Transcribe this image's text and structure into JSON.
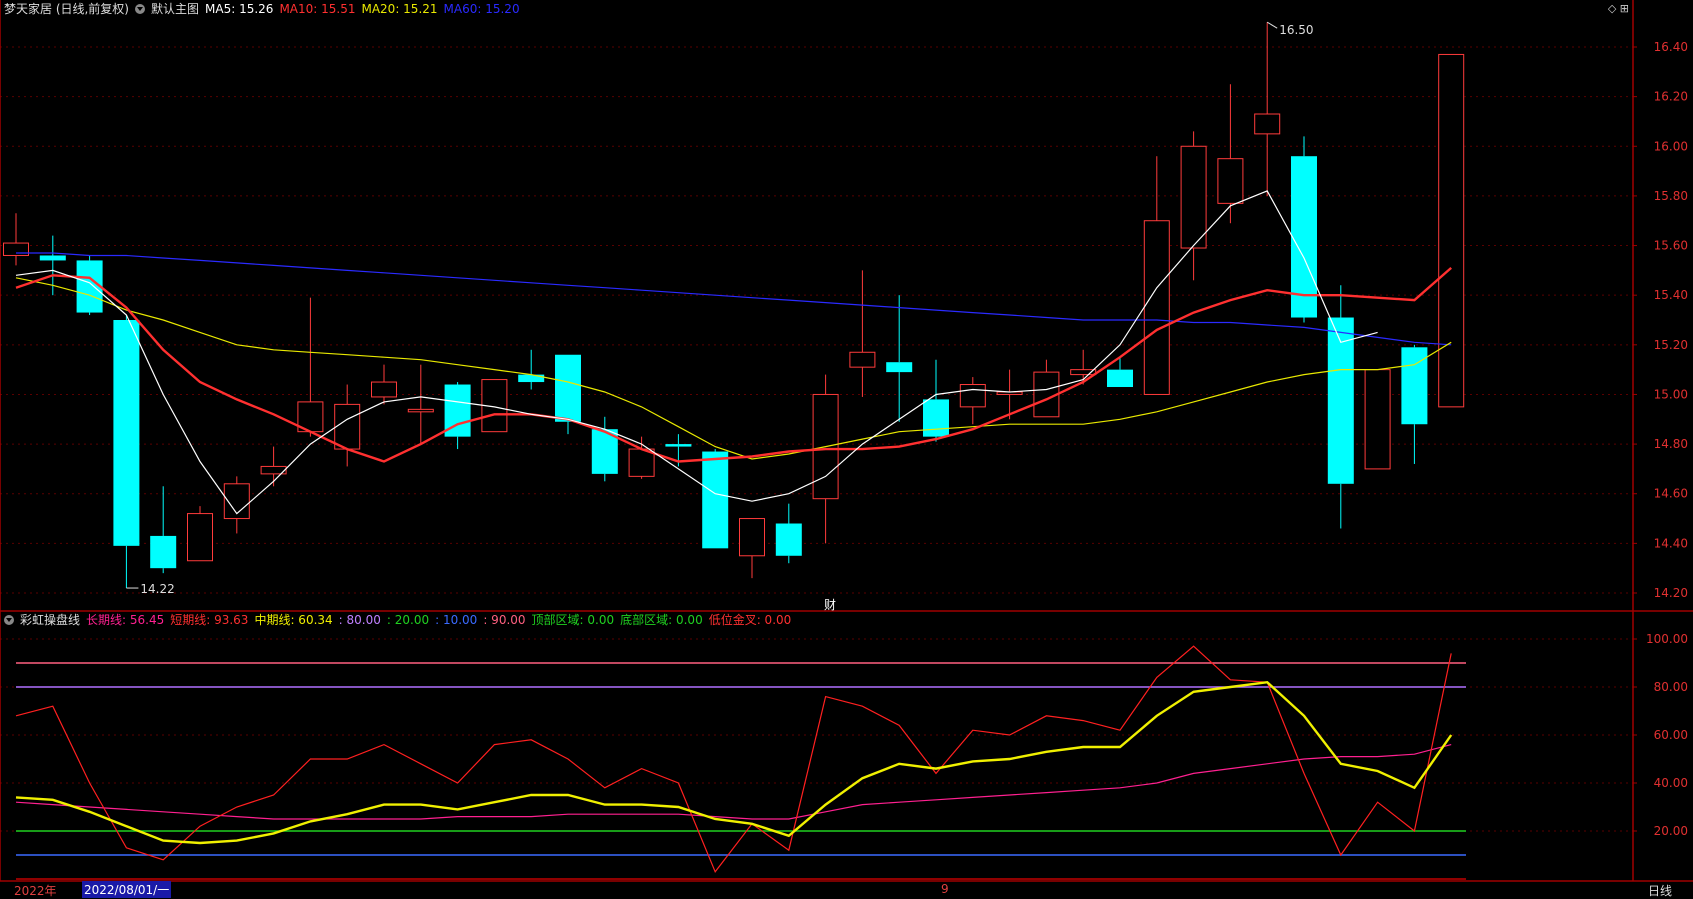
{
  "header": {
    "stock_name": "梦天家居 (日线,前复权)",
    "chart_type_label": "默认主图",
    "ma": [
      {
        "label": "MA5: 15.26",
        "color": "#ffffff"
      },
      {
        "label": "MA10: 15.51",
        "color": "#ff3030"
      },
      {
        "label": "MA20: 15.21",
        "color": "#e8e800"
      },
      {
        "label": "MA60: 15.20",
        "color": "#2a2aff"
      }
    ]
  },
  "indicator_header": {
    "name": "彩虹操盘线",
    "items": [
      {
        "label": "长期线: 56.45",
        "color": "#ff2090"
      },
      {
        "label": "短期线: 93.63",
        "color": "#ff3030"
      },
      {
        "label": "中期线: 60.34",
        "color": "#f0f000"
      },
      {
        "label": ": 80.00",
        "color": "#c080ff"
      },
      {
        "label": ": 20.00",
        "color": "#20d020"
      },
      {
        "label": ": 10.00",
        "color": "#3a6aff"
      },
      {
        "label": ": 90.00",
        "color": "#ff6080"
      },
      {
        "label": "顶部区域: 0.00",
        "color": "#20d020"
      },
      {
        "label": "底部区域: 0.00",
        "color": "#20d020"
      },
      {
        "label": "低位金叉: 0.00",
        "color": "#ff3030"
      }
    ]
  },
  "corner_icons": "◇ ⊞",
  "timeline": {
    "year_label": "2022年",
    "cursor_date": "2022/08/01/一",
    "mid_label": "9",
    "period": "日线"
  },
  "marker_cai": "财",
  "annotations": {
    "high": "16.50",
    "low": "14.22"
  },
  "colors": {
    "up": "#ff3b3b",
    "down": "#00ffff",
    "grid": "#5a0000",
    "axis": "#a00000"
  },
  "chart_data": [
    {
      "type": "candlestick",
      "title": "梦天家居",
      "ylim": [
        14.14,
        16.6
      ],
      "y_ticks": [
        14.2,
        14.4,
        14.6,
        14.8,
        15.0,
        15.2,
        15.4,
        15.6,
        15.8,
        16.0,
        16.2,
        16.4
      ],
      "candles": [
        {
          "o": 15.56,
          "h": 15.73,
          "l": 15.52,
          "c": 15.61
        },
        {
          "o": 15.56,
          "h": 15.64,
          "l": 15.4,
          "c": 15.54
        },
        {
          "o": 15.54,
          "h": 15.56,
          "l": 15.32,
          "c": 15.33
        },
        {
          "o": 15.3,
          "h": 15.32,
          "l": 14.22,
          "c": 14.39
        },
        {
          "o": 14.43,
          "h": 14.63,
          "l": 14.28,
          "c": 14.3
        },
        {
          "o": 14.33,
          "h": 14.55,
          "l": 14.33,
          "c": 14.52
        },
        {
          "o": 14.5,
          "h": 14.67,
          "l": 14.44,
          "c": 14.64
        },
        {
          "o": 14.68,
          "h": 14.79,
          "l": 14.63,
          "c": 14.71
        },
        {
          "o": 14.85,
          "h": 15.39,
          "l": 14.83,
          "c": 14.97
        },
        {
          "o": 14.78,
          "h": 15.04,
          "l": 14.71,
          "c": 14.96
        },
        {
          "o": 14.99,
          "h": 15.12,
          "l": 14.96,
          "c": 15.05
        },
        {
          "o": 14.93,
          "h": 15.12,
          "l": 14.8,
          "c": 14.94
        },
        {
          "o": 15.04,
          "h": 15.05,
          "l": 14.78,
          "c": 14.83
        },
        {
          "o": 14.85,
          "h": 15.06,
          "l": 14.85,
          "c": 15.06
        },
        {
          "o": 15.08,
          "h": 15.18,
          "l": 15.02,
          "c": 15.05
        },
        {
          "o": 15.16,
          "h": 15.16,
          "l": 14.84,
          "c": 14.89
        },
        {
          "o": 14.86,
          "h": 14.91,
          "l": 14.65,
          "c": 14.68
        },
        {
          "o": 14.67,
          "h": 14.83,
          "l": 14.66,
          "c": 14.78
        },
        {
          "o": 14.8,
          "h": 14.84,
          "l": 14.71,
          "c": 14.79
        },
        {
          "o": 14.77,
          "h": 14.78,
          "l": 14.38,
          "c": 14.38
        },
        {
          "o": 14.35,
          "h": 14.5,
          "l": 14.26,
          "c": 14.5
        },
        {
          "o": 14.48,
          "h": 14.56,
          "l": 14.32,
          "c": 14.35
        },
        {
          "o": 14.58,
          "h": 15.08,
          "l": 14.4,
          "c": 15.0
        },
        {
          "o": 15.11,
          "h": 15.5,
          "l": 14.99,
          "c": 15.17
        },
        {
          "o": 15.13,
          "h": 15.4,
          "l": 14.89,
          "c": 15.09
        },
        {
          "o": 14.98,
          "h": 15.14,
          "l": 14.81,
          "c": 14.83
        },
        {
          "o": 14.95,
          "h": 15.07,
          "l": 14.88,
          "c": 15.04
        },
        {
          "o": 15.0,
          "h": 15.1,
          "l": 14.9,
          "c": 15.01
        },
        {
          "o": 14.91,
          "h": 15.14,
          "l": 14.91,
          "c": 15.09
        },
        {
          "o": 15.08,
          "h": 15.18,
          "l": 15.04,
          "c": 15.1
        },
        {
          "o": 15.1,
          "h": 15.15,
          "l": 15.04,
          "c": 15.03
        },
        {
          "o": 15.0,
          "h": 15.96,
          "l": 15.0,
          "c": 15.7
        },
        {
          "o": 15.59,
          "h": 16.06,
          "l": 15.46,
          "c": 16.0
        },
        {
          "o": 15.77,
          "h": 16.25,
          "l": 15.69,
          "c": 15.95
        },
        {
          "o": 16.05,
          "h": 16.5,
          "l": 15.8,
          "c": 16.13
        },
        {
          "o": 15.96,
          "h": 16.04,
          "l": 15.29,
          "c": 15.31
        },
        {
          "o": 15.31,
          "h": 15.44,
          "l": 14.46,
          "c": 14.64
        },
        {
          "o": 14.7,
          "h": 15.1,
          "l": 14.7,
          "c": 15.1
        },
        {
          "o": 15.19,
          "h": 15.2,
          "l": 14.72,
          "c": 14.88
        },
        {
          "o": 14.95,
          "h": 16.37,
          "l": 14.95,
          "c": 16.37
        }
      ],
      "ma5": [
        15.48,
        15.5,
        15.45,
        15.32,
        15.0,
        14.73,
        14.52,
        14.65,
        14.8,
        14.9,
        14.97,
        14.99,
        14.97,
        14.95,
        14.92,
        14.9,
        14.86,
        14.8,
        14.7,
        14.6,
        14.57,
        14.6,
        14.67,
        14.8,
        14.9,
        15.0,
        15.02,
        15.01,
        15.02,
        15.06,
        15.2,
        15.43,
        15.6,
        15.76,
        15.82,
        15.55,
        15.21,
        15.25
      ],
      "ma10": [
        15.43,
        15.48,
        15.47,
        15.35,
        15.18,
        15.05,
        14.98,
        14.92,
        14.85,
        14.78,
        14.73,
        14.8,
        14.88,
        14.92,
        14.92,
        14.9,
        14.85,
        14.78,
        14.73,
        14.74,
        14.75,
        14.77,
        14.78,
        14.78,
        14.79,
        14.82,
        14.86,
        14.92,
        14.98,
        15.05,
        15.15,
        15.26,
        15.33,
        15.38,
        15.42,
        15.4,
        15.4,
        15.39,
        15.38,
        15.51
      ],
      "ma20": [
        15.47,
        15.44,
        15.4,
        15.34,
        15.3,
        15.25,
        15.2,
        15.18,
        15.17,
        15.16,
        15.15,
        15.14,
        15.12,
        15.1,
        15.08,
        15.05,
        15.01,
        14.95,
        14.87,
        14.79,
        14.74,
        14.76,
        14.79,
        14.82,
        14.85,
        14.86,
        14.87,
        14.88,
        14.88,
        14.88,
        14.9,
        14.93,
        14.97,
        15.01,
        15.05,
        15.08,
        15.1,
        15.1,
        15.12,
        15.21
      ],
      "ma60": [
        15.57,
        15.57,
        15.56,
        15.56,
        15.55,
        15.54,
        15.53,
        15.52,
        15.51,
        15.5,
        15.49,
        15.48,
        15.47,
        15.46,
        15.45,
        15.44,
        15.43,
        15.42,
        15.41,
        15.4,
        15.39,
        15.38,
        15.37,
        15.36,
        15.35,
        15.34,
        15.33,
        15.32,
        15.31,
        15.3,
        15.3,
        15.3,
        15.29,
        15.29,
        15.28,
        15.27,
        15.25,
        15.23,
        15.21,
        15.2
      ]
    },
    {
      "type": "line",
      "title": "彩虹操盘线",
      "ylim": [
        5,
        108
      ],
      "y_ticks": [
        20,
        40,
        60,
        80,
        100
      ],
      "levels": [
        {
          "value": 90,
          "color": "#ff6080"
        },
        {
          "value": 80,
          "color": "#b070ff"
        },
        {
          "value": 20,
          "color": "#20d020"
        },
        {
          "value": 10,
          "color": "#3a6aff"
        }
      ],
      "series": [
        {
          "name": "长期线",
          "color": "#ff2090",
          "values": [
            32,
            31,
            30,
            29,
            28,
            27,
            26,
            25,
            25,
            25,
            25,
            25,
            26,
            26,
            26,
            27,
            27,
            27,
            27,
            26,
            25,
            25,
            28,
            31,
            32,
            33,
            34,
            35,
            36,
            37,
            38,
            40,
            44,
            46,
            48,
            50,
            51,
            51,
            52,
            56
          ]
        },
        {
          "name": "短期线",
          "color": "#ff2020",
          "values": [
            68,
            72,
            40,
            13,
            8,
            22,
            30,
            35,
            50,
            50,
            56,
            48,
            40,
            56,
            58,
            50,
            38,
            46,
            40,
            3,
            23,
            12,
            76,
            72,
            64,
            44,
            62,
            60,
            68,
            66,
            62,
            84,
            97,
            83,
            82,
            44,
            10,
            32,
            20,
            94
          ]
        },
        {
          "name": "中期线",
          "color": "#f0f000",
          "values": [
            34,
            33,
            28,
            22,
            16,
            15,
            16,
            19,
            24,
            27,
            31,
            31,
            29,
            32,
            35,
            35,
            31,
            31,
            30,
            25,
            23,
            18,
            31,
            42,
            48,
            46,
            49,
            50,
            53,
            55,
            55,
            68,
            78,
            80,
            82,
            68,
            48,
            45,
            38,
            60
          ]
        }
      ]
    }
  ]
}
